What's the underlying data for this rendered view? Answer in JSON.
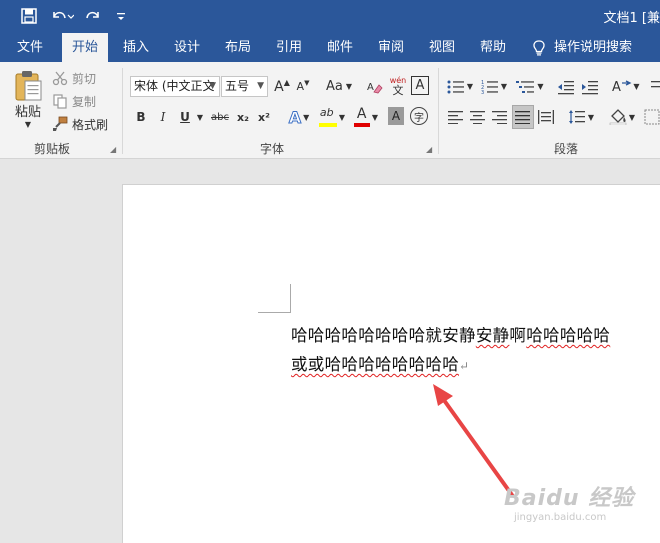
{
  "title_bar": {
    "document_title": "文档1 [兼"
  },
  "quick_access": {
    "save_icon": "save-icon",
    "undo_icon": "undo-icon",
    "redo_icon": "redo-icon",
    "customize_icon": "customize-icon"
  },
  "tabs": {
    "file": "文件",
    "home": "开始",
    "insert": "插入",
    "design": "设计",
    "layout": "布局",
    "references": "引用",
    "mailings": "邮件",
    "review": "审阅",
    "view": "视图",
    "help": "帮助",
    "search": "操作说明搜索"
  },
  "clipboard": {
    "paste": "粘贴",
    "cut": "剪切",
    "copy": "复制",
    "format_painter": "格式刷",
    "group_label": "剪贴板"
  },
  "font": {
    "font_name": "宋体 (中文正文",
    "font_size": "五号",
    "grow": "A",
    "shrink": "A",
    "change_case": "Aa",
    "phonetic_top": "wén",
    "phonetic_bottom": "文",
    "char_border": "A",
    "bold": "B",
    "italic": "I",
    "underline": "U",
    "strikethrough": "abc",
    "subscript": "x₂",
    "superscript": "x²",
    "text_effects": "A",
    "highlight": "ab",
    "font_color": "A",
    "char_shading": "A",
    "enclose": "字",
    "group_label": "字体"
  },
  "paragraph": {
    "group_label": "段落"
  },
  "document": {
    "line1_normal": "哈哈哈哈哈哈哈哈就安静",
    "line1_squiggle1": "安静",
    "line1_middle": "啊",
    "line1_squiggle2": "哈哈哈哈哈",
    "line2_text": "或或哈哈哈哈哈哈哈哈",
    "para_mark": "↵"
  },
  "watermark": {
    "main": "Baidu 经验",
    "sub": "jingyan.baidu.com"
  },
  "colors": {
    "ribbon_blue": "#2b579a",
    "annotation_red": "#e84545",
    "highlight_yellow": "#ffff00",
    "font_red": "#e00000"
  }
}
